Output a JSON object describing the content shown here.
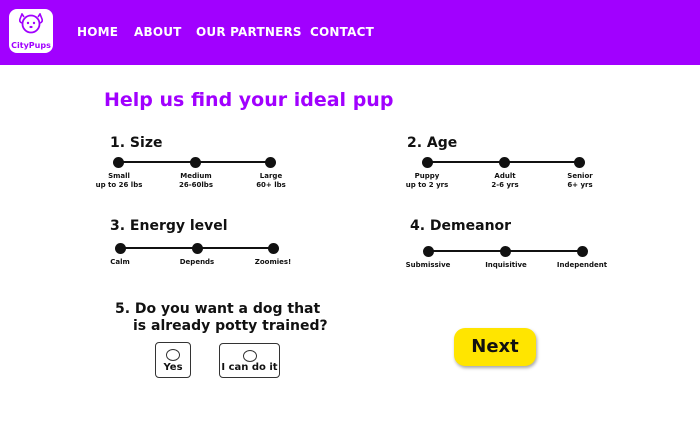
{
  "header": {
    "logo_text": "CityPups",
    "nav": [
      {
        "label": "HOME"
      },
      {
        "label": "ABOUT"
      },
      {
        "label": "OUR PARTNERS"
      },
      {
        "label": "CONTACT"
      }
    ]
  },
  "main": {
    "title": "Help us find your ideal pup",
    "questions": {
      "size": {
        "title": "1. Size",
        "options": [
          {
            "label": "Small\nup to 26 lbs"
          },
          {
            "label": "Medium\n26-60lbs"
          },
          {
            "label": "Large\n60+ lbs"
          }
        ]
      },
      "age": {
        "title": "2. Age",
        "options": [
          {
            "label": "Puppy\nup to 2 yrs"
          },
          {
            "label": "Adult\n2-6 yrs"
          },
          {
            "label": "Senior\n6+ yrs"
          }
        ]
      },
      "energy": {
        "title": "3. Energy level",
        "options": [
          {
            "label": "Calm"
          },
          {
            "label": "Depends"
          },
          {
            "label": "Zoomies!"
          }
        ]
      },
      "demeanor": {
        "title": "4. Demeanor",
        "options": [
          {
            "label": "Submissive"
          },
          {
            "label": "Inquisitive"
          },
          {
            "label": "Independent"
          }
        ]
      },
      "potty": {
        "title_line1": "5. Do you want a dog that",
        "title_line2": "is already potty trained?",
        "options": [
          {
            "label": "Yes"
          },
          {
            "label": "I can do it"
          }
        ]
      }
    },
    "next_label": "Next"
  },
  "colors": {
    "brand_purple": "#A100FF",
    "button_yellow": "#FFE500"
  }
}
